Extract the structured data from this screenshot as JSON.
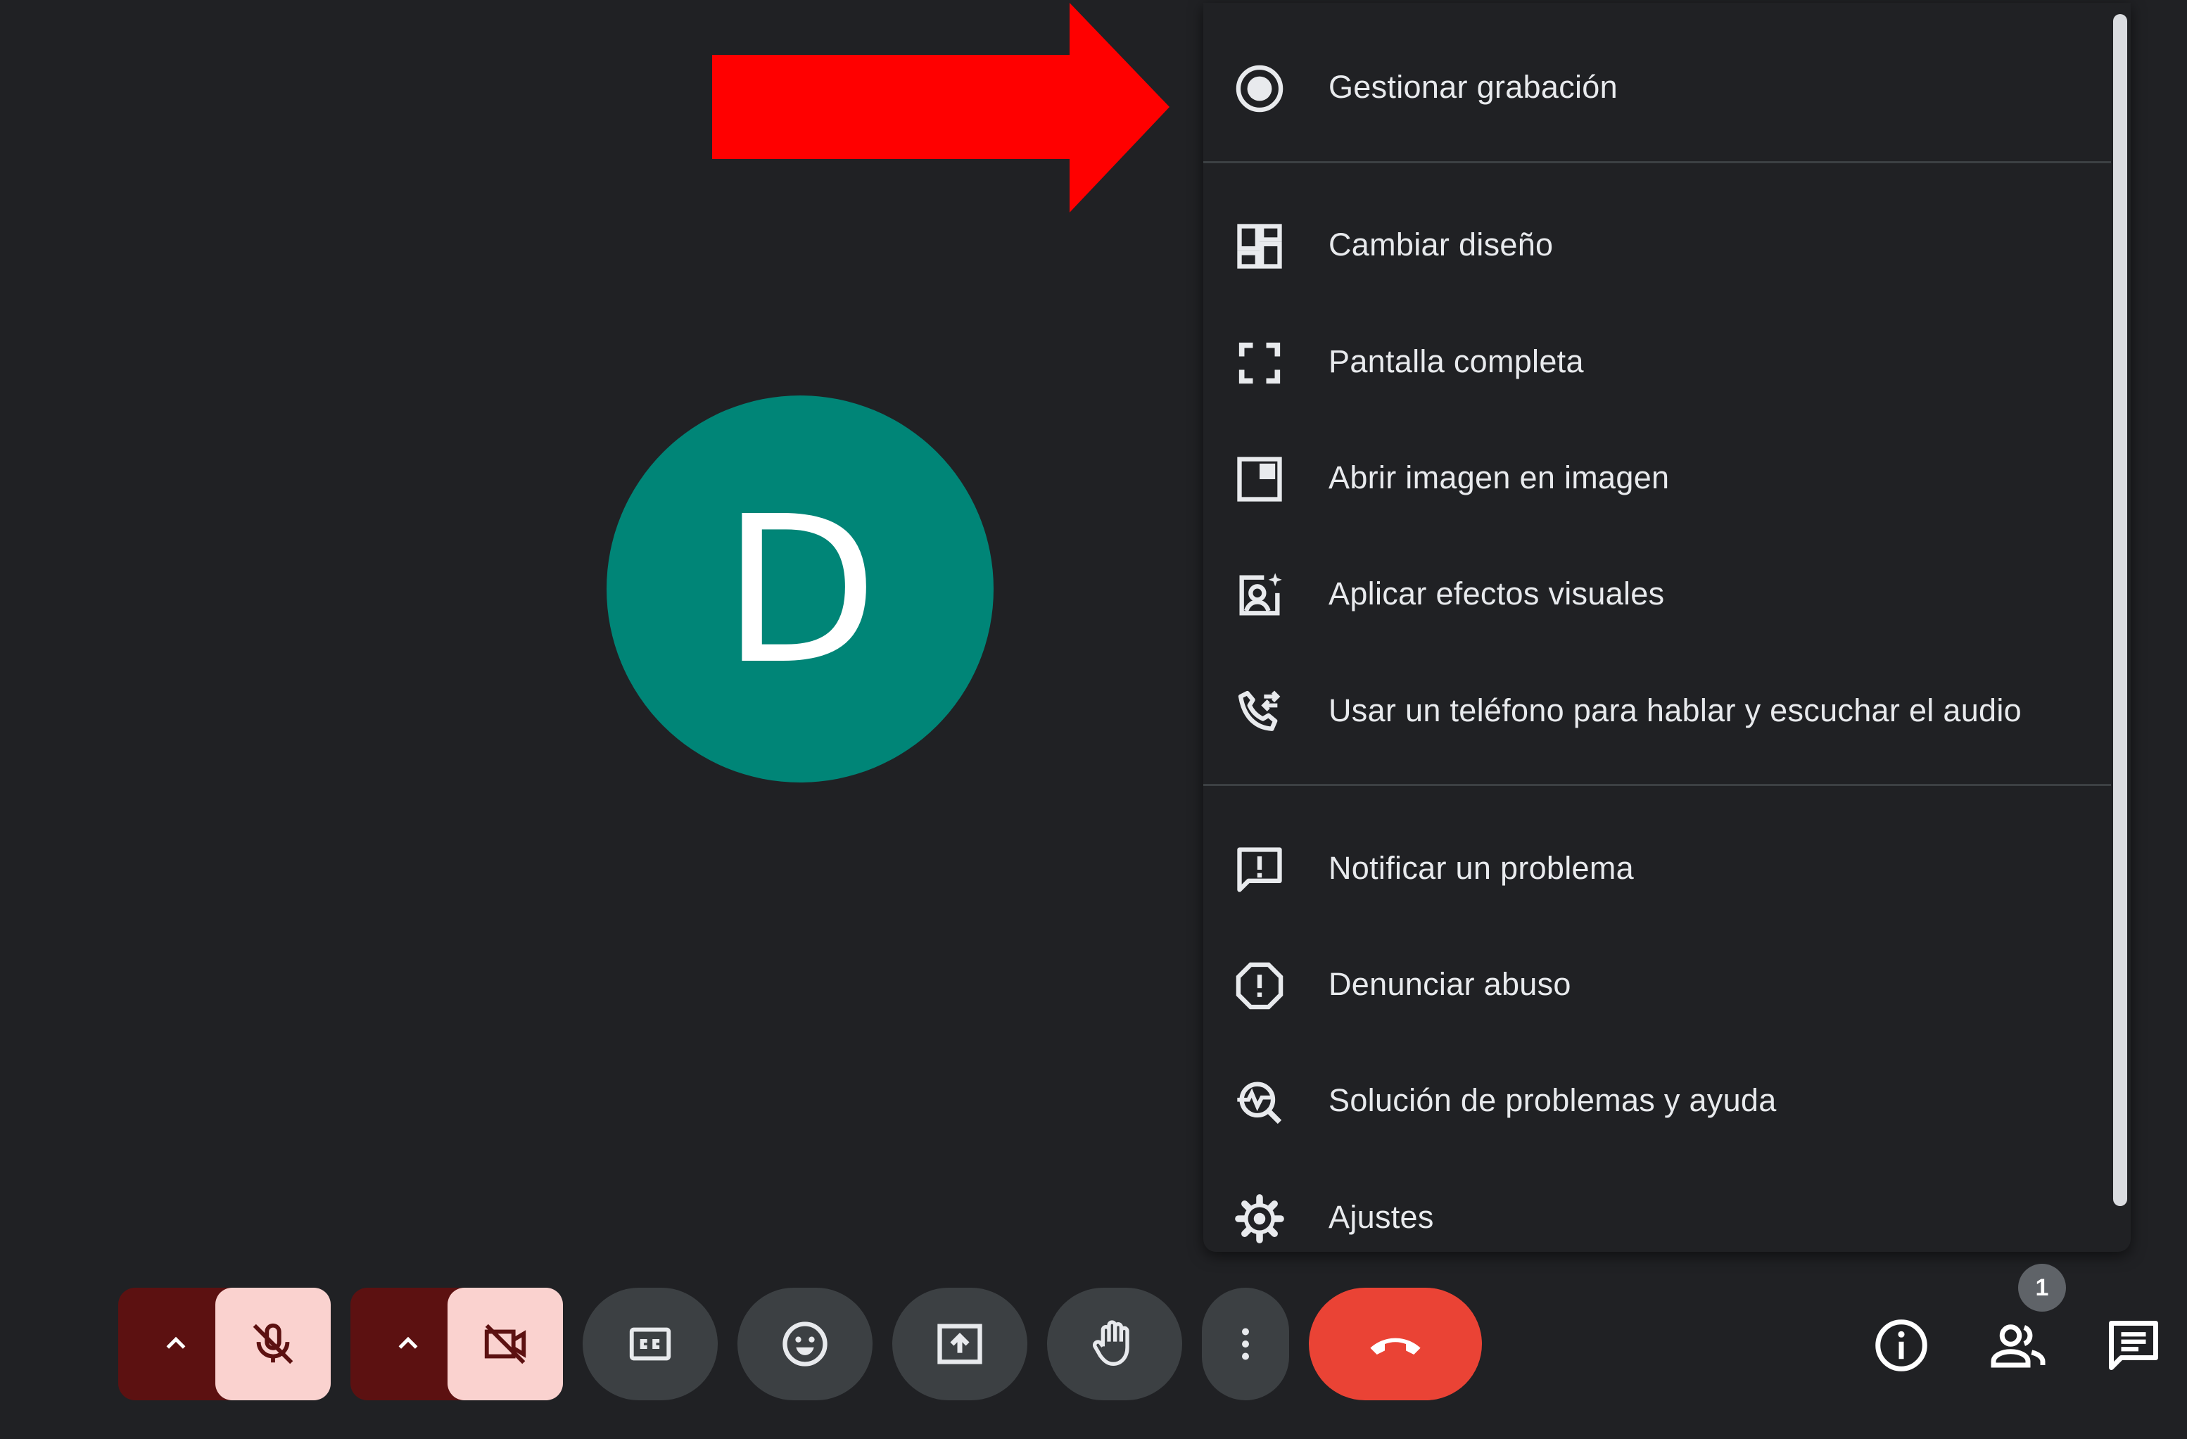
{
  "avatar": {
    "initial": "D",
    "color": "#008577"
  },
  "annotation": {
    "arrow_color": "#ff0000"
  },
  "menu": {
    "items": [
      {
        "label": "Gestionar grabación",
        "icon": "record-icon"
      },
      {
        "label": "Cambiar diseño",
        "icon": "layout-icon"
      },
      {
        "label": "Pantalla completa",
        "icon": "fullscreen-icon"
      },
      {
        "label": "Abrir imagen en imagen",
        "icon": "picture-in-picture-icon"
      },
      {
        "label": "Aplicar efectos visuales",
        "icon": "visual-effects-icon"
      },
      {
        "label": "Usar un teléfono para hablar y escuchar el audio",
        "icon": "phone-forward-icon"
      },
      {
        "label": "Notificar un problema",
        "icon": "feedback-icon"
      },
      {
        "label": "Denunciar abuso",
        "icon": "report-icon"
      },
      {
        "label": "Solución de problemas y ayuda",
        "icon": "troubleshoot-icon"
      },
      {
        "label": "Ajustes",
        "icon": "settings-icon"
      }
    ]
  },
  "controls": {
    "participants_count": "1",
    "end_call_color": "#ea4335",
    "muted_bg": "#fad2cf",
    "muted_dark": "#5c1111"
  }
}
